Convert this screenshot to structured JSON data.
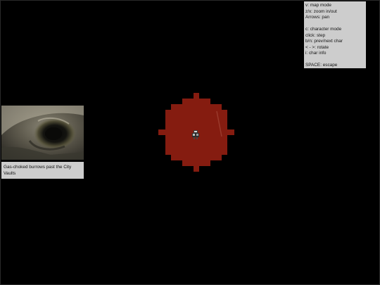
{
  "help": {
    "lines": [
      "v: map mode",
      "z/x: zoom in/out",
      "Arrows: pan",
      "",
      "c: character mode",
      "click: step",
      "b/n: prev/next char",
      "< - >: rotate",
      "i: char info",
      "",
      "SPACE: escape"
    ]
  },
  "location": {
    "caption": "Gas-choked burrows past the City Vaults"
  },
  "colors": {
    "floor": "#851c10",
    "panel": "#cdcdcd",
    "background": "#000000"
  },
  "icons": {
    "character": "character-sprite-icon"
  }
}
